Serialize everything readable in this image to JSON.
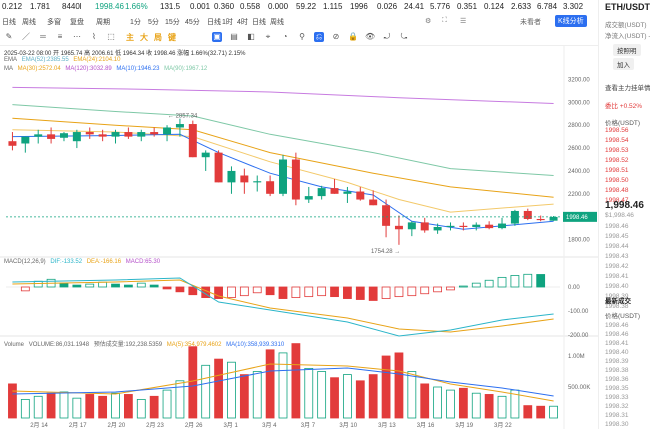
{
  "ticker": {
    "items": [
      "0.212",
      "1.781",
      "8440l",
      "ETH/USDT",
      "1998.46",
      "1.66%",
      "131.5",
      "0.001",
      "0.360",
      "0.558",
      "0.000",
      "59.22",
      "1.115",
      "1996",
      "0.026",
      "24.41",
      "5.776",
      "0.351",
      "0.124",
      "2.633",
      "6.784",
      "3.302"
    ]
  },
  "toolbar": {
    "items": [
      "日线",
      "周线",
      "多窗",
      "复盘",
      "周期",
      "1分",
      "5分",
      "15分",
      "45分",
      "日线",
      "1时",
      "4时",
      "日线",
      "周线"
    ],
    "right_status": "未看者",
    "analysis_button": "K线分析"
  },
  "drawbar": {
    "chips": [
      "主",
      "大",
      "局",
      "键"
    ]
  },
  "legend": {
    "info_line": "2025-03-22 08:00  开 1965.74  高 2006.61  低 1964.34  收 1998.46  涨幅 1.66%(32.71)  2.15%",
    "ema": [
      "EMA",
      "EMA(52):2385.55",
      "EMA(24):2104.10"
    ],
    "ma": [
      "MA",
      "MA(30):2572.04",
      "MA(120):3032.89",
      "MA(10):1946.23",
      "MA(90):1967.12"
    ],
    "macd": [
      "MACD(12,26,9)",
      "DIF:-133.52",
      "DEA:-166.16",
      "MACD:65.30"
    ],
    "volume": [
      "Volume",
      "VOLUME:86,031.1948",
      "预估成交量:192,238.5359",
      "MA(5):354,979.4602",
      "MA(10):358,939.3310"
    ]
  },
  "annotations": {
    "high": "← 2857.34",
    "low": "1754.28 →",
    "current_price": "1998.46"
  },
  "price_axis": [
    "3200.00",
    "3000.00",
    "2800.00",
    "2600.00",
    "2400.00",
    "2200.00",
    "2000.00",
    "1800.00"
  ],
  "macd_axis": [
    "0.00",
    "-100.00",
    "-200.00"
  ],
  "vol_axis": [
    "1.00M",
    "500.00K"
  ],
  "date_axis": [
    "2月 14",
    "2月 17",
    "2月 20",
    "2月 23",
    "2月 26",
    "3月 1",
    "3月 4",
    "3月 7",
    "3月 10",
    "3月 13",
    "3月 16",
    "3月 19",
    "3月 22"
  ],
  "right_panel": {
    "title": "ETH/USDT",
    "rows": [
      "成交额(USDT)",
      "净流入(USDT)  -68",
      "",
      "",
      "",
      "",
      "查看主力挂单情",
      "委比  +0.52%",
      "价格(USDT)"
    ],
    "buttons": [
      "按照明",
      "加入"
    ],
    "current": "1,998.46",
    "current_sub": "$1,998.46",
    "asks": [
      "1998.56",
      "1998.54",
      "1998.53",
      "1998.52",
      "1998.51",
      "1998.50",
      "1998.48",
      "1998.47"
    ],
    "bids": [
      "1998.46",
      "1998.45",
      "1998.44",
      "1998.43",
      "1998.42",
      "1998.41",
      "1998.40",
      "1998.39",
      "1998.38"
    ],
    "trades_title": "最新成交",
    "trades_price_label": "价格(USDT)",
    "trades": [
      "1998.46",
      "1998.46",
      "1998.41",
      "1998.40",
      "1998.39",
      "1998.38",
      "1998.36",
      "1998.35",
      "1998.33",
      "1998.32",
      "1998.31",
      "1998.30"
    ]
  },
  "colors": {
    "up": "#0fa37f",
    "down": "#e23b3b",
    "accent": "#2c6ff0"
  },
  "chart_data": {
    "type": "candlestick",
    "ylim": [
      1700,
      3300
    ],
    "candles": [
      [
        2660,
        2740,
        2580,
        2620
      ],
      [
        2640,
        2700,
        2560,
        2700
      ],
      [
        2700,
        2760,
        2640,
        2720
      ],
      [
        2720,
        2780,
        2640,
        2680
      ],
      [
        2690,
        2740,
        2660,
        2730
      ],
      [
        2660,
        2760,
        2600,
        2740
      ],
      [
        2740,
        2780,
        2680,
        2720
      ],
      [
        2720,
        2760,
        2660,
        2700
      ],
      [
        2700,
        2760,
        2640,
        2740
      ],
      [
        2740,
        2780,
        2680,
        2700
      ],
      [
        2700,
        2760,
        2660,
        2740
      ],
      [
        2740,
        2780,
        2700,
        2720
      ],
      [
        2720,
        2800,
        2660,
        2780
      ],
      [
        2780,
        2857,
        2700,
        2810
      ],
      [
        2810,
        2840,
        2520,
        2520
      ],
      [
        2520,
        2580,
        2400,
        2560
      ],
      [
        2560,
        2580,
        2300,
        2300
      ],
      [
        2300,
        2440,
        2200,
        2400
      ],
      [
        2360,
        2420,
        2200,
        2300
      ],
      [
        2300,
        2360,
        2220,
        2310
      ],
      [
        2310,
        2360,
        2180,
        2200
      ],
      [
        2200,
        2540,
        2180,
        2500
      ],
      [
        2500,
        2560,
        2100,
        2150
      ],
      [
        2150,
        2260,
        2120,
        2180
      ],
      [
        2180,
        2270,
        2150,
        2250
      ],
      [
        2250,
        2330,
        2200,
        2200
      ],
      [
        2200,
        2260,
        2120,
        2220
      ],
      [
        2220,
        2260,
        2140,
        2150
      ],
      [
        2150,
        2230,
        2100,
        2100
      ],
      [
        2100,
        2150,
        1820,
        1920
      ],
      [
        1920,
        2010,
        1754,
        1890
      ],
      [
        1890,
        1960,
        1830,
        1950
      ],
      [
        1950,
        1990,
        1860,
        1880
      ],
      [
        1880,
        1940,
        1850,
        1910
      ],
      [
        1910,
        1950,
        1880,
        1920
      ],
      [
        1920,
        1950,
        1880,
        1910
      ],
      [
        1910,
        1950,
        1880,
        1930
      ],
      [
        1930,
        1960,
        1890,
        1900
      ],
      [
        1900,
        1990,
        1890,
        1940
      ],
      [
        1940,
        2060,
        1920,
        2050
      ],
      [
        2050,
        2070,
        1970,
        1980
      ],
      [
        1980,
        2010,
        1960,
        1970
      ],
      [
        1965,
        2006,
        1964,
        1998
      ]
    ],
    "macd": [
      -20,
      30,
      40,
      20,
      10,
      15,
      25,
      15,
      10,
      20,
      10,
      -10,
      -25,
      -40,
      -55,
      -60,
      -55,
      -45,
      -30,
      -40,
      -60,
      -55,
      -50,
      -45,
      -50,
      -60,
      -65,
      -70,
      -60,
      -50,
      -45,
      -35,
      -25,
      -15,
      5,
      20,
      35,
      50,
      60,
      66,
      65
    ],
    "volume": [
      0.55,
      0.3,
      0.35,
      0.4,
      0.42,
      0.32,
      0.38,
      0.35,
      0.4,
      0.38,
      0.3,
      0.35,
      0.45,
      0.6,
      1.15,
      0.85,
      0.95,
      0.9,
      0.7,
      0.75,
      1.1,
      1.05,
      1.2,
      0.8,
      0.75,
      0.65,
      0.7,
      0.6,
      0.7,
      1.0,
      1.05,
      0.75,
      0.55,
      0.5,
      0.45,
      0.48,
      0.4,
      0.38,
      0.35,
      0.45,
      0.2,
      0.19,
      0.19
    ]
  }
}
